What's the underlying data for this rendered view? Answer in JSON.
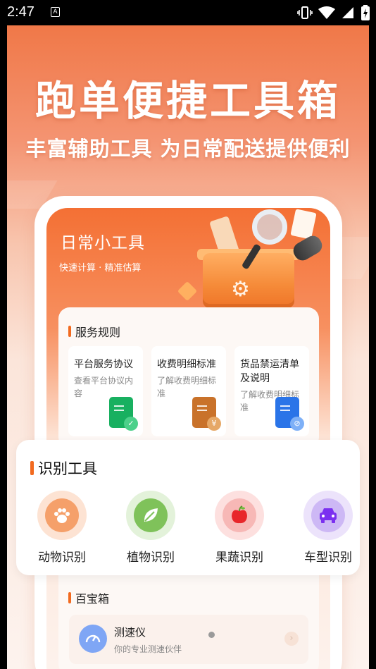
{
  "status_bar": {
    "time": "2:47",
    "notification_icon": "A"
  },
  "hero": {
    "title": "跑单便捷工具箱",
    "subtitle": "丰富辅助工具 为日常配送提供便利"
  },
  "phone": {
    "header_title": "日常小工具",
    "header_subtitle": "快速计算 · 精准估算",
    "rules": {
      "heading": "服务规则",
      "items": [
        {
          "title": "平台服务协议",
          "desc": "查看平台协议内容",
          "icon": "document-shield-icon",
          "color": "#18b060",
          "badge": "✓"
        },
        {
          "title": "收费明细标准",
          "desc": "了解收费明细标准",
          "icon": "receipt-yen-icon",
          "color": "#c9722a",
          "badge": "¥"
        },
        {
          "title": "货品禁运清单及说明",
          "desc": "了解收费明细标准",
          "icon": "document-forbidden-icon",
          "color": "#2a74e8",
          "badge": "⊘"
        }
      ]
    },
    "treasure": {
      "heading": "百宝箱",
      "tool_name": "测速仪",
      "tool_desc": "你的专业测速伙伴"
    }
  },
  "recognition": {
    "heading": "识别工具",
    "tools": [
      {
        "label": "动物识别",
        "icon": "paw-icon",
        "halo": "#fde3d3",
        "core": "#f5a06a"
      },
      {
        "label": "植物识别",
        "icon": "leaf-icon",
        "halo": "#e3f2da",
        "core": "#7fc25a"
      },
      {
        "label": "果蔬识别",
        "icon": "apple-icon",
        "halo": "#fde0df",
        "core": "#f7b8b6"
      },
      {
        "label": "车型识别",
        "icon": "car-icon",
        "halo": "#ece3fb",
        "core": "#cdb8f5"
      }
    ]
  },
  "colors": {
    "accent": "#f26a1f",
    "hero_top": "#f07848"
  }
}
